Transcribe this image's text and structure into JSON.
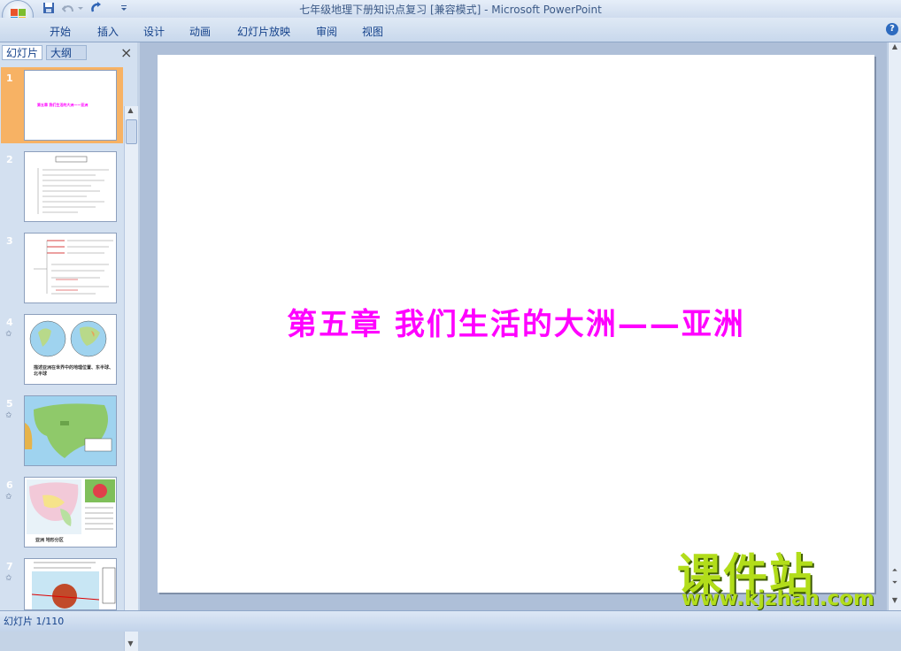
{
  "window": {
    "title": "七年级地理下册知识点复习 [兼容模式] - Microsoft PowerPoint"
  },
  "quick_access": {
    "save_icon": "save-icon",
    "undo_icon": "undo-icon",
    "redo_icon": "redo-icon",
    "customize_icon": "dropdown-icon"
  },
  "ribbon": {
    "tabs": [
      "开始",
      "插入",
      "设计",
      "动画",
      "幻灯片放映",
      "审阅",
      "视图"
    ],
    "help_icon": "help-icon"
  },
  "panel": {
    "tabs": [
      "幻灯片",
      "大纲"
    ],
    "close_label": "×"
  },
  "thumbnails": [
    {
      "num": "1",
      "text": "第五章 我们生活的大洲——亚洲"
    },
    {
      "num": "2",
      "text": ""
    },
    {
      "num": "3",
      "text": ""
    },
    {
      "num": "4",
      "text": "描述亚洲在世界中的地理位置、东半球、北半球"
    },
    {
      "num": "5",
      "text": ""
    },
    {
      "num": "6",
      "text": "亚洲 地形分区"
    },
    {
      "num": "7",
      "text": ""
    }
  ],
  "slide": {
    "title": "第五章 我们生活的大洲——亚洲"
  },
  "watermark": {
    "title": "课件站",
    "url": "www.kjzhan.com"
  },
  "statusbar": {
    "text": "幻灯片 1/110"
  },
  "colors": {
    "accent": "#ff00ff",
    "selected_thumb": "#f7b264",
    "watermark": "#b2dd1a"
  }
}
